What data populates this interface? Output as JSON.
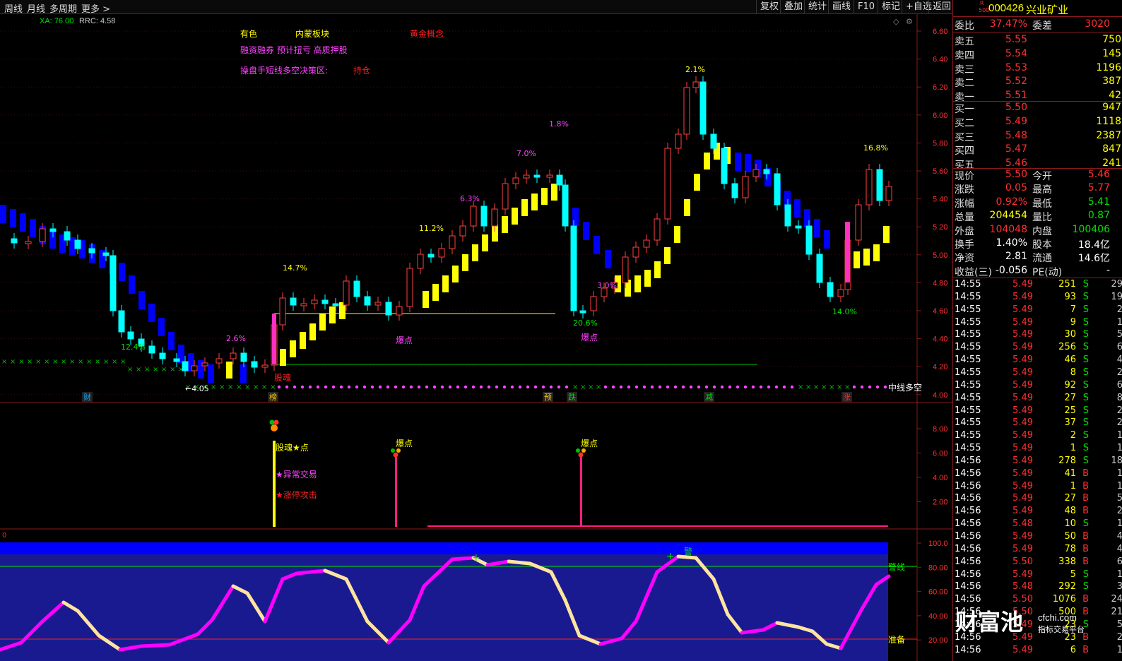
{
  "toolbar": {
    "left": [
      "周线",
      "月线",
      "多周期",
      "更多 >"
    ],
    "right": [
      "复权",
      "叠加",
      "统计",
      "画线",
      "F10",
      "标记",
      "+自选",
      "返回"
    ]
  },
  "indicator": {
    "xa": "XA: 76.00",
    "rrc": "RRC: 4.58"
  },
  "concepts": {
    "c1": "有色",
    "c2": "内蒙板块",
    "c3": "黄金概念",
    "c4": "融资融券 预计扭亏 高质押股",
    "c5": "操盘手短线多空决策区:",
    "c6": "持仓"
  },
  "price_axis": [
    "6.60",
    "6.40",
    "6.20",
    "6.00",
    "5.80",
    "5.60",
    "5.40",
    "5.20",
    "5.00",
    "4.80",
    "4.60",
    "4.40",
    "4.20",
    "4.00"
  ],
  "mid_axis": [
    "8.00",
    "6.00",
    "4.00",
    "2.00"
  ],
  "osc_axis": [
    "100.0",
    "80.00",
    "60.00",
    "40.00",
    "20.00"
  ],
  "osc_zero": "0",
  "chart_labels": {
    "pct": [
      "2.1%",
      "1.8%",
      "7.0%",
      "6.3%",
      "11.2%",
      "14.7%",
      "2.6%",
      "12.4%",
      "3.0%",
      "20.6%",
      "16.8%",
      "14.0%"
    ],
    "low": "←4.05",
    "baopo": "爆点",
    "baopo2": "爆点",
    "fuhun": "股魂",
    "midline": "中线多空",
    "bottom_tags": [
      "财",
      "榜",
      "预",
      "跌",
      "减",
      "涨"
    ],
    "mid_notes": [
      "股魂★点",
      "★异常交易",
      "★涨停攻击"
    ],
    "mid_baopo": [
      "爆点",
      "爆点"
    ],
    "warn": "警线",
    "ready": "准备",
    "osc_top_mark": "警"
  },
  "stock": {
    "r_badge": "R",
    "r_num": "500",
    "code": "000426",
    "name": "兴业矿业"
  },
  "order_head": {
    "label": "委比",
    "value": "37.47%",
    "label2": "委差",
    "value2": "3020"
  },
  "sells": [
    {
      "label": "卖五",
      "price": "5.55",
      "vol": "750"
    },
    {
      "label": "卖四",
      "price": "5.54",
      "vol": "145"
    },
    {
      "label": "卖三",
      "price": "5.53",
      "vol": "1196"
    },
    {
      "label": "卖二",
      "price": "5.52",
      "vol": "387"
    },
    {
      "label": "卖一",
      "price": "5.51",
      "vol": "42"
    }
  ],
  "buys": [
    {
      "label": "买一",
      "price": "5.50",
      "vol": "947"
    },
    {
      "label": "买二",
      "price": "5.49",
      "vol": "1118"
    },
    {
      "label": "买三",
      "price": "5.48",
      "vol": "2387"
    },
    {
      "label": "买四",
      "price": "5.47",
      "vol": "847"
    },
    {
      "label": "买五",
      "price": "5.46",
      "vol": "241"
    }
  ],
  "stats": [
    {
      "l1": "现价",
      "v1": "5.50",
      "l2": "今开",
      "v2": "5.46",
      "c1": "#ff3030",
      "c2": "#ff3030"
    },
    {
      "l1": "涨跌",
      "v1": "0.05",
      "l2": "最高",
      "v2": "5.77",
      "c1": "#ff3030",
      "c2": "#ff3030"
    },
    {
      "l1": "涨幅",
      "v1": "0.92%",
      "l2": "最低",
      "v2": "5.41",
      "c1": "#ff3030",
      "c2": "#00e000"
    },
    {
      "l1": "总量",
      "v1": "204454",
      "l2": "量比",
      "v2": "0.87",
      "c1": "#ffff00",
      "c2": "#00e000"
    },
    {
      "l1": "外盘",
      "v1": "104048",
      "l2": "内盘",
      "v2": "100406",
      "c1": "#ff3030",
      "c2": "#00e000"
    },
    {
      "l1": "换手",
      "v1": "1.40%",
      "l2": "股本",
      "v2": "18.4亿",
      "c1": "#ffffff",
      "c2": "#ffffff"
    },
    {
      "l1": "净资",
      "v1": "2.81",
      "l2": "流通",
      "v2": "14.6亿",
      "c1": "#ffffff",
      "c2": "#ffffff"
    },
    {
      "l1": "收益(三)",
      "v1": "-0.056",
      "l2": "PE(动)",
      "v2": "-",
      "c1": "#ffffff",
      "c2": "#ffffff"
    }
  ],
  "ticks": [
    {
      "t": "14:55",
      "p": "5.49",
      "v": "251",
      "s": "S",
      "n": "29"
    },
    {
      "t": "14:55",
      "p": "5.49",
      "v": "93",
      "s": "S",
      "n": "19"
    },
    {
      "t": "14:55",
      "p": "5.49",
      "v": "7",
      "s": "S",
      "n": "2"
    },
    {
      "t": "14:55",
      "p": "5.49",
      "v": "9",
      "s": "S",
      "n": "1"
    },
    {
      "t": "14:55",
      "p": "5.49",
      "v": "30",
      "s": "S",
      "n": "5"
    },
    {
      "t": "14:55",
      "p": "5.49",
      "v": "256",
      "s": "S",
      "n": "6"
    },
    {
      "t": "14:55",
      "p": "5.49",
      "v": "46",
      "s": "S",
      "n": "4"
    },
    {
      "t": "14:55",
      "p": "5.49",
      "v": "8",
      "s": "S",
      "n": "2"
    },
    {
      "t": "14:55",
      "p": "5.49",
      "v": "92",
      "s": "S",
      "n": "6"
    },
    {
      "t": "14:55",
      "p": "5.49",
      "v": "27",
      "s": "S",
      "n": "8"
    },
    {
      "t": "14:55",
      "p": "5.49",
      "v": "25",
      "s": "S",
      "n": "2"
    },
    {
      "t": "14:55",
      "p": "5.49",
      "v": "37",
      "s": "S",
      "n": "2"
    },
    {
      "t": "14:55",
      "p": "5.49",
      "v": "2",
      "s": "S",
      "n": "1"
    },
    {
      "t": "14:55",
      "p": "5.49",
      "v": "1",
      "s": "S",
      "n": "1"
    },
    {
      "t": "14:56",
      "p": "5.49",
      "v": "278",
      "s": "S",
      "n": "18"
    },
    {
      "t": "14:56",
      "p": "5.49",
      "v": "41",
      "s": "B",
      "n": "1"
    },
    {
      "t": "14:56",
      "p": "5.49",
      "v": "1",
      "s": "B",
      "n": "1"
    },
    {
      "t": "14:56",
      "p": "5.49",
      "v": "27",
      "s": "B",
      "n": "5"
    },
    {
      "t": "14:56",
      "p": "5.49",
      "v": "48",
      "s": "B",
      "n": "2"
    },
    {
      "t": "14:56",
      "p": "5.48",
      "v": "10",
      "s": "S",
      "n": "1"
    },
    {
      "t": "14:56",
      "p": "5.49",
      "v": "50",
      "s": "B",
      "n": "4"
    },
    {
      "t": "14:56",
      "p": "5.49",
      "v": "78",
      "s": "B",
      "n": "4"
    },
    {
      "t": "14:56",
      "p": "5.50",
      "v": "338",
      "s": "B",
      "n": "6"
    },
    {
      "t": "14:56",
      "p": "5.49",
      "v": "5",
      "s": "S",
      "n": "1"
    },
    {
      "t": "14:56",
      "p": "5.48",
      "v": "292",
      "s": "S",
      "n": "3"
    },
    {
      "t": "14:56",
      "p": "5.50",
      "v": "1076",
      "s": "B",
      "n": "24"
    },
    {
      "t": "14:56",
      "p": "5.50",
      "v": "500",
      "s": "B",
      "n": "21"
    },
    {
      "t": "14:56",
      "p": "5.49",
      "v": "23",
      "s": "S",
      "n": "5"
    },
    {
      "t": "14:56",
      "p": "5.49",
      "v": "23",
      "s": "B",
      "n": "2"
    },
    {
      "t": "14:56",
      "p": "5.49",
      "v": "6",
      "s": "B",
      "n": "1"
    }
  ],
  "watermark": {
    "brand": "财富池",
    "site": "cfchi.com",
    "slogan": "指标交易平台"
  },
  "colors": {
    "up": "#ff3030",
    "down": "#00ffff",
    "bear": "#0000ff",
    "bull": "#ffff00",
    "magenta": "#ff00ff",
    "green": "#00e000",
    "bg": "#000000"
  }
}
